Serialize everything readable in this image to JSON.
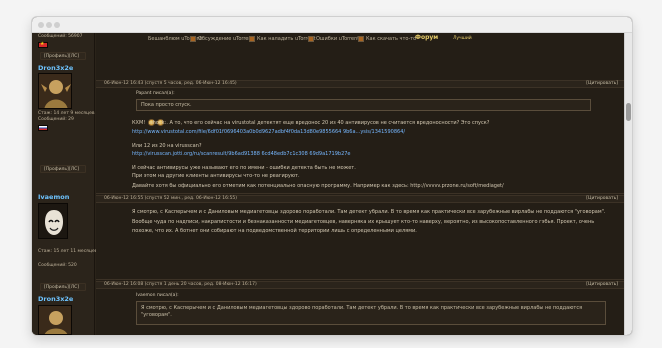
{
  "top_links": {
    "items": [
      "Бешанблюм uTorrent",
      "Обсуждение uTorrent",
      "Как наладить uTorrent",
      "Ошибки uTorrent",
      "Как скачать что-то"
    ],
    "right_logo_text": "Форум",
    "right_small": "Лучший"
  },
  "left_users": [
    {
      "id": "top_user",
      "messages": "Сообщений: 56907"
    },
    {
      "id": "dron",
      "name": "Dron3x2e",
      "since": "Стаж: 14 лет 9 месяцев",
      "messages": "Сообщений: 29",
      "buttons": [
        "[Профиль]",
        "[ЛС]"
      ]
    },
    {
      "id": "ivan",
      "name": "Ivaemon",
      "since": "Стаж: 15 лет 11 месяцев",
      "messages": "Сообщений: 520",
      "buttons": [
        "[Профиль]",
        "[ЛС]"
      ]
    },
    {
      "id": "dron_2",
      "name": "Dron3x2e",
      "since": "",
      "messages": "",
      "buttons": [
        "[Профиль]",
        "[ЛС]"
      ]
    }
  ],
  "posts": [
    {
      "id": "p1",
      "meta": "06-Июн-12 16:43 (спустя 5 часов, ред. 06-Июн-12 16:45)",
      "cite": "[Цитировать]",
      "quote_author": "Papant писал(а):",
      "quote_text": "Пока просто спуск.",
      "lines": [
        "КХМ!  :shock:. А то, что его сейчас на virustotal детектят еще вредонос 20 из 40 антивирусов не считается вредоносности? Это спуск?",
        "http://www.virustotal.com/file/6df01f0696403a0b0d9627adbf4f0da13d80e9855664 9b6a...ysis/1341590864/",
        "Или 12 из 20 на virusscan?",
        "http://virusscan.jotti.org/ru/scanresult/9b6ad91388 6cd48edb7c1c308 69d9a1719b27e",
        "И сейчас антивирусы уже называют его по имени - ошибки детекта быть не может.",
        "При этом на другие клиенты антивирусы что-то не реагируют.",
        "Давайте хотя бы официально его отметим как потенциально опасную программу. Например как здесь: http://vvvvv.przone.ru/soft/mediaget/"
      ]
    },
    {
      "id": "p2",
      "meta": "06-Июн-12 16:55 (спустя 52 мин., ред. 06-Июн-12 16:55)",
      "cite": "[Цитировать]",
      "lines": [
        "Я смотрю, с Касперычем и с Даниловым медиагетовцы здорово поработали. Там детект убрали. В то время как практически все зарубежные вирлабы не поддаются \"уговорам\".",
        "Вообще чуда по надписи, накрапистости и безнаказанности медиагетовцев, наверняка их крышует кто-то наверху, вероятно, из высокопоставленного гэбья. Проект, очень",
        "похоже, что их. А ботнет они собирают на подведомственной территории лишь с определенными целями."
      ]
    },
    {
      "id": "p3",
      "meta": "06-Июн-12 16:08 (спустя 1 день 20 часов, ред. 08-Июн-12 16:17)",
      "cite": "[Цитировать]",
      "quote_author": "Ivaemon писал(а):",
      "quote_text": "Я смотрю, с Касперычем и с Даниловым медиагетовцы здорово поработали. Там детект убрали. В то время как практически все зарубежные вирлабы не поддаются \"уговорам\"."
    }
  ]
}
